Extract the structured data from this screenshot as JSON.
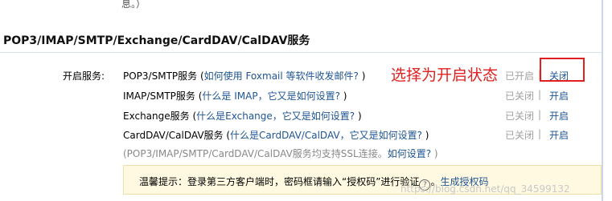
{
  "top_note": "息。）",
  "section_title": "POP3/IMAP/SMTP/Exchange/CardDAV/CalDAV服务",
  "service_label": "开启服务:",
  "services": [
    {
      "name": "POP3/SMTP服务",
      "open_paren": " (",
      "help": "如何使用 Foxmail 等软件收发邮件?",
      "close_paren": " )",
      "state": "已开启",
      "sep": "|",
      "action": "关闭"
    },
    {
      "name": "IMAP/SMTP服务",
      "open_paren": " (",
      "help": "什么是 IMAP，它又是如何设置?",
      "close_paren": " )",
      "state": "已关闭",
      "sep": "|",
      "action": "开启"
    },
    {
      "name": "Exchange服务",
      "open_paren": " (",
      "help": "什么是Exchange，它又是如何设置?",
      "close_paren": " )",
      "state": "已关闭",
      "sep": "|",
      "action": "开启"
    },
    {
      "name": "CardDAV/CalDAV服务",
      "open_paren": " (",
      "help": "什么是CardDAV/CalDAV，它又是如何设置?",
      "close_paren": " )",
      "state": "已关闭",
      "sep": "|",
      "action": "开启"
    }
  ],
  "ssl_note": {
    "text": "(POP3/IMAP/SMTP/CardDAV/CalDAV服务均支持SSL连接。",
    "help": "如何设置?",
    "close": " )"
  },
  "annotation": "选择为开启状态",
  "tip": {
    "text": "温馨提示：登录第三方客户端时，密码框请输入“授权码”进行验证",
    "icon": "question-circle-icon",
    "icon_glyph": "?",
    "link": "生成授权码"
  },
  "watermark": "https://blog.csdn.net/qq_34599132",
  "colors": {
    "link": "#1e5494",
    "annotation": "#e02020",
    "tip_bg": "#fff9e1",
    "muted": "#a0a0a0"
  }
}
